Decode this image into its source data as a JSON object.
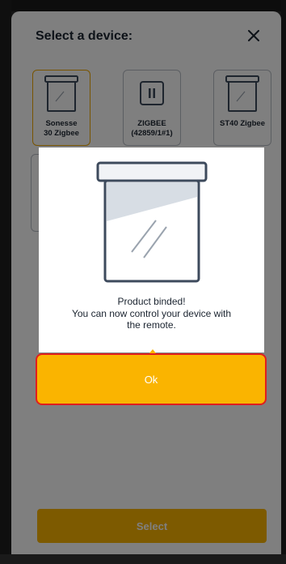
{
  "sheet": {
    "title": "Select a device:",
    "close_icon": "close-icon",
    "devices": [
      {
        "label_line1": "Sonesse",
        "label_line2": "30 Zigbee",
        "icon": "window-device-icon",
        "selected": true
      },
      {
        "label_line1": "ZIGBEE",
        "label_line2": "(42859/1#1)",
        "icon": "pause-switch-icon",
        "selected": false
      },
      {
        "label_line1": "ST40 Zigbee",
        "label_line2": "",
        "icon": "window-device-icon",
        "selected": false
      }
    ],
    "select_label": "Select"
  },
  "modal": {
    "image": "window-device-icon",
    "message_lines": [
      "Product binded!",
      "You can now control your device with",
      "the remote."
    ],
    "ok_label": "Ok"
  },
  "colors": {
    "accent": "#fab400",
    "highlight_border": "#e01e1e",
    "text": "#1b2430",
    "selected_border": "#f0a800"
  }
}
